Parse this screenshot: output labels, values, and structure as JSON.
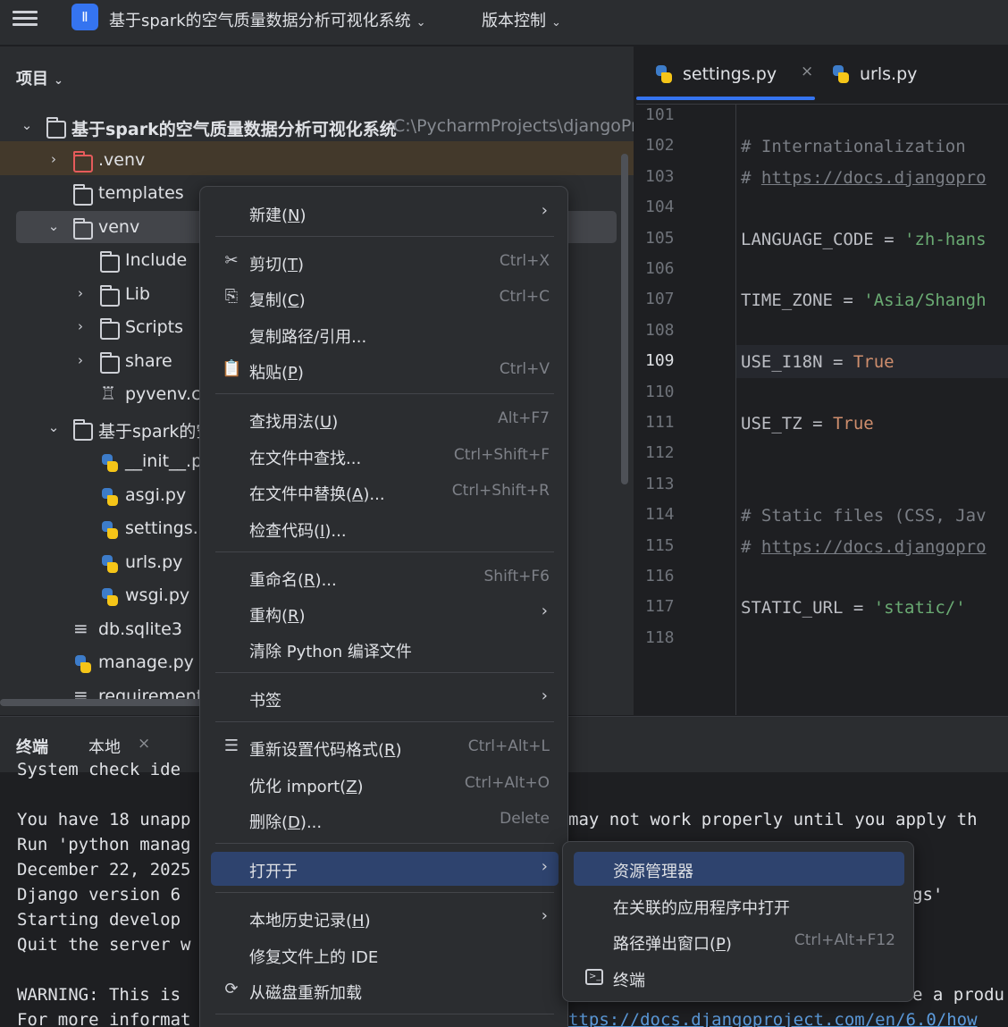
{
  "topbar": {
    "project_badge": "Ⅱ",
    "project_name": "基于spark的空气质量数据分析可视化系统",
    "vcs_label": "版本控制"
  },
  "project_panel": {
    "header": "项目",
    "tree": [
      {
        "label": "基于spark的空气质量数据分析可视化系统",
        "path": "C:\\PycharmProjects\\djangoPr",
        "icon": "folder-icon",
        "arrow": "⌄"
      },
      {
        "label": ".venv",
        "icon": "folder-icon",
        "arrow": "›"
      },
      {
        "label": "templates",
        "icon": "folder-icon",
        "arrow": ""
      },
      {
        "label": "venv",
        "icon": "folder-icon",
        "arrow": "⌄"
      },
      {
        "label": "Include",
        "icon": "folder-icon",
        "arrow": ""
      },
      {
        "label": "Lib",
        "icon": "folder-icon",
        "arrow": "›"
      },
      {
        "label": "Scripts",
        "icon": "folder-icon",
        "arrow": "›"
      },
      {
        "label": "share",
        "icon": "folder-icon",
        "arrow": "›"
      },
      {
        "label": "pyvenv.cf",
        "icon": "config-icon",
        "arrow": ""
      },
      {
        "label": "基于spark的空",
        "icon": "package-folder-icon",
        "arrow": "⌄"
      },
      {
        "label": "__init__.p",
        "icon": "python-file-icon",
        "arrow": ""
      },
      {
        "label": "asgi.py",
        "icon": "python-file-icon",
        "arrow": ""
      },
      {
        "label": "settings.p",
        "icon": "python-file-icon",
        "arrow": ""
      },
      {
        "label": "urls.py",
        "icon": "python-file-icon",
        "arrow": ""
      },
      {
        "label": "wsgi.py",
        "icon": "python-file-icon",
        "arrow": ""
      },
      {
        "label": "db.sqlite3",
        "icon": "text-file-icon",
        "arrow": ""
      },
      {
        "label": "manage.py",
        "icon": "python-file-icon",
        "arrow": ""
      },
      {
        "label": "requirement",
        "icon": "text-file-icon",
        "arrow": ""
      }
    ]
  },
  "editor": {
    "tabs": [
      {
        "label": "settings.py",
        "close": "×",
        "active": true
      },
      {
        "label": "urls.py",
        "active": false
      }
    ],
    "current_line": 109,
    "lines": [
      {
        "n": "101",
        "parts": []
      },
      {
        "n": "102",
        "parts": [
          {
            "t": "# Internationalization",
            "c": "cmt"
          }
        ]
      },
      {
        "n": "103",
        "parts": [
          {
            "t": "# ",
            "c": "cmt"
          },
          {
            "t": "https://docs.djangopro",
            "c": "url"
          }
        ]
      },
      {
        "n": "104",
        "parts": []
      },
      {
        "n": "105",
        "parts": [
          {
            "t": "LANGUAGE_CODE = ",
            "c": ""
          },
          {
            "t": "'zh-hans",
            "c": "str"
          }
        ]
      },
      {
        "n": "106",
        "parts": []
      },
      {
        "n": "107",
        "parts": [
          {
            "t": "TIME_ZONE = ",
            "c": ""
          },
          {
            "t": "'Asia/Shangh",
            "c": "str"
          }
        ]
      },
      {
        "n": "108",
        "parts": []
      },
      {
        "n": "109",
        "parts": [
          {
            "t": "USE_I18N = ",
            "c": ""
          },
          {
            "t": "True",
            "c": "kw"
          }
        ]
      },
      {
        "n": "110",
        "parts": []
      },
      {
        "n": "111",
        "parts": [
          {
            "t": "USE_TZ = ",
            "c": ""
          },
          {
            "t": "True",
            "c": "kw"
          }
        ]
      },
      {
        "n": "112",
        "parts": []
      },
      {
        "n": "113",
        "parts": []
      },
      {
        "n": "114",
        "parts": [
          {
            "t": "# Static files (CSS, Jav",
            "c": "cmt"
          }
        ]
      },
      {
        "n": "115",
        "parts": [
          {
            "t": "# ",
            "c": "cmt"
          },
          {
            "t": "https://docs.djangopro",
            "c": "url"
          }
        ]
      },
      {
        "n": "116",
        "parts": []
      },
      {
        "n": "117",
        "parts": [
          {
            "t": "STATIC_URL = ",
            "c": ""
          },
          {
            "t": "'static/'",
            "c": "str"
          }
        ]
      },
      {
        "n": "118",
        "parts": []
      }
    ]
  },
  "terminal": {
    "title": "终端",
    "tab_local": "本地",
    "tab_close": "×",
    "lines": [
      {
        "text": "System check ide",
        "link": false
      },
      {
        "text": "You have 18 unapp",
        "link": false
      },
      {
        "text": "Run 'python manag",
        "link": false
      },
      {
        "text": "December 22, 2025",
        "link": false
      },
      {
        "text": "Django version 6",
        "link": false
      },
      {
        "text": "Starting develop",
        "link": false
      },
      {
        "text": "Quit the server w",
        "link": false
      },
      {
        "text": "",
        "link": false
      },
      {
        "text": "WARNING: This is",
        "link": false
      },
      {
        "text": "For more informat",
        "link": false
      }
    ],
    "right_fragments": {
      "line1": "may not work properly until you apply th",
      "line4": "gs'",
      "line8": "e a produ",
      "line9": "ttps://docs.djangoproject.com/en/6.0/how"
    }
  },
  "context_menu": {
    "items": [
      {
        "name": "new",
        "label": "新建",
        "mn": "N",
        "shortcut": "",
        "submenu": true,
        "icon": ""
      },
      {
        "sep": true
      },
      {
        "name": "cut",
        "label": "剪切",
        "mn": "T",
        "shortcut": "Ctrl+X",
        "icon": "scissors-icon"
      },
      {
        "name": "copy",
        "label": "复制",
        "mn": "C",
        "shortcut": "Ctrl+C",
        "icon": "copy-icon"
      },
      {
        "name": "copy-path",
        "label": "复制路径/引用...",
        "mn": "",
        "shortcut": "",
        "icon": ""
      },
      {
        "name": "paste",
        "label": "粘贴",
        "mn": "P",
        "shortcut": "Ctrl+V",
        "icon": "paste-icon"
      },
      {
        "sep": true
      },
      {
        "name": "find-usages",
        "label": "查找用法",
        "mn": "U",
        "shortcut": "Alt+F7",
        "icon": ""
      },
      {
        "name": "find-in-files",
        "label": "在文件中查找...",
        "mn": "",
        "shortcut": "Ctrl+Shift+F",
        "icon": ""
      },
      {
        "name": "replace-in-files",
        "label": "在文件中替换",
        "mn": "A",
        "suffix": "...",
        "shortcut": "Ctrl+Shift+R",
        "icon": ""
      },
      {
        "name": "inspect-code",
        "label": "检查代码",
        "mn": "I",
        "suffix": "...",
        "shortcut": "",
        "icon": ""
      },
      {
        "sep": true
      },
      {
        "name": "rename",
        "label": "重命名",
        "mn": "R",
        "suffix": "...",
        "shortcut": "Shift+F6",
        "icon": ""
      },
      {
        "name": "refactor",
        "label": "重构",
        "mn": "R",
        "shortcut": "",
        "submenu": true,
        "icon": ""
      },
      {
        "name": "clean-python",
        "label": "清除 Python 编译文件",
        "mn": "",
        "shortcut": "",
        "icon": ""
      },
      {
        "sep": true
      },
      {
        "name": "bookmarks",
        "label": "书签",
        "mn": "",
        "shortcut": "",
        "submenu": true,
        "icon": ""
      },
      {
        "sep": true
      },
      {
        "name": "reformat-code",
        "label": "重新设置代码格式",
        "mn": "R",
        "shortcut": "Ctrl+Alt+L",
        "icon": "reformat-icon"
      },
      {
        "name": "optimize-imports",
        "label": "优化 import",
        "mn": "Z",
        "shortcut": "Ctrl+Alt+O",
        "icon": ""
      },
      {
        "name": "delete",
        "label": "删除",
        "mn": "D",
        "suffix": "...",
        "shortcut": "Delete",
        "icon": ""
      },
      {
        "sep": true
      },
      {
        "name": "open-in",
        "label": "打开于",
        "mn": "",
        "shortcut": "",
        "submenu": true,
        "selected": true,
        "icon": ""
      },
      {
        "sep": true
      },
      {
        "name": "local-history",
        "label": "本地历史记录",
        "mn": "H",
        "shortcut": "",
        "submenu": true,
        "icon": ""
      },
      {
        "name": "repair-ide",
        "label": "修复文件上的 IDE",
        "mn": "",
        "shortcut": "",
        "icon": ""
      },
      {
        "name": "reload-from-disk",
        "label": "从磁盘重新加载",
        "mn": "",
        "shortcut": "",
        "icon": "reload-icon"
      },
      {
        "sep": true
      }
    ],
    "submenu_arrow": "›"
  },
  "open_in_submenu": {
    "items": [
      {
        "name": "explorer",
        "label": "资源管理器",
        "mn": "",
        "shortcut": "",
        "selected": true
      },
      {
        "name": "associated-app",
        "label": "在关联的应用程序中打开",
        "mn": "",
        "shortcut": ""
      },
      {
        "name": "path-popup",
        "label": "路径弹出窗口",
        "mn": "P",
        "shortcut": "Ctrl+Alt+F12"
      },
      {
        "name": "terminal",
        "label": "终端",
        "mn": "",
        "shortcut": "",
        "icon": "terminal-icon"
      }
    ]
  },
  "colors": {
    "accent": "#3574f0",
    "selection": "#2e436e",
    "panel": "#2b2d30",
    "editor_bg": "#1e1f22"
  }
}
